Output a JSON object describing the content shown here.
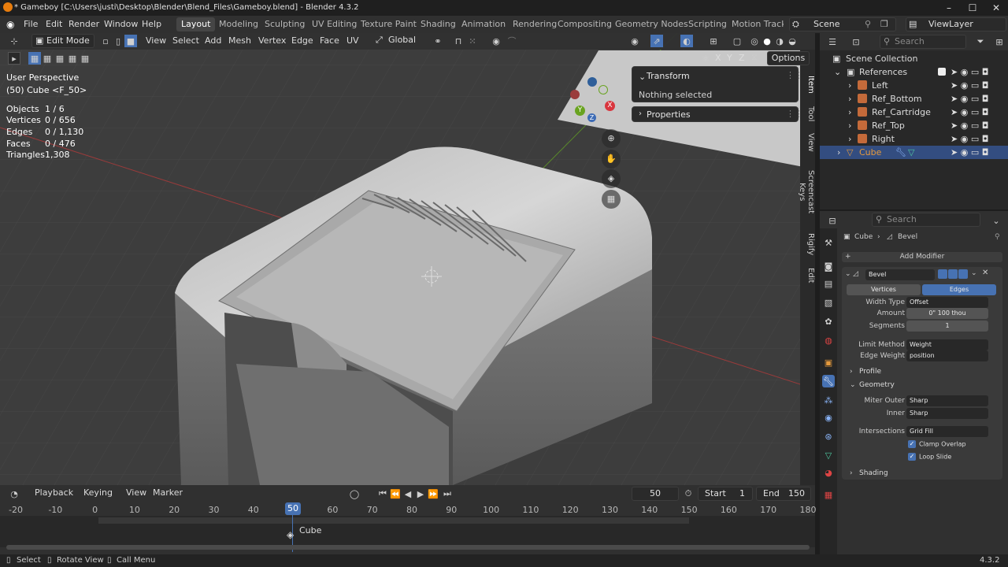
{
  "titlebar": {
    "title": "* Gameboy [C:\\Users\\justi\\Desktop\\Blender\\Blend_Files\\Gameboy.blend] - Blender 4.3.2"
  },
  "menus": [
    "File",
    "Edit",
    "Render",
    "Window",
    "Help"
  ],
  "workspaces": [
    "Layout",
    "Modeling",
    "Sculpting",
    "UV Editing",
    "Texture Paint",
    "Shading",
    "Animation",
    "Rendering",
    "Compositing",
    "Geometry Nodes",
    "Scripting",
    "Motion Tracki"
  ],
  "scene": "Scene",
  "view_layer": "ViewLayer",
  "viewport_header": {
    "mode": "Edit Mode",
    "menus": [
      "View",
      "Select",
      "Add",
      "Mesh",
      "Vertex",
      "Edge",
      "Face",
      "UV"
    ],
    "transform_orientation": "Global",
    "options_label": "Options",
    "axes": [
      "X",
      "Y",
      "Z"
    ]
  },
  "overlay_info": {
    "view_name": "User Perspective",
    "object_name": "(50) Cube <F_50>",
    "stats": [
      {
        "label": "Objects",
        "value": "1 / 6"
      },
      {
        "label": "Vertices",
        "value": "0 / 656"
      },
      {
        "label": "Edges",
        "value": "0 / 1,130"
      },
      {
        "label": "Faces",
        "value": "0 / 476"
      },
      {
        "label": "Triangles",
        "value": "1,308"
      }
    ]
  },
  "gizmo": {
    "x": "X",
    "y": "Y",
    "z": "Z"
  },
  "npanel": {
    "transform_title": "Transform",
    "transform_body": "Nothing selected",
    "properties_title": "Properties",
    "tabs": [
      "Item",
      "Tool",
      "View",
      "Screencast Keys",
      "Rigify",
      "Edit"
    ]
  },
  "outliner": {
    "search_placeholder": "Search",
    "root": "Scene Collection",
    "collection": "References",
    "items": [
      "Left",
      "Ref_Bottom",
      "Ref_Cartridge",
      "Ref_Top",
      "Right",
      "Cube"
    ]
  },
  "properties": {
    "search_placeholder": "Search",
    "breadcrumb_object": "Cube",
    "breadcrumb_modifier": "Bevel",
    "add_modifier": "Add Modifier",
    "modifier_name": "Bevel",
    "affect_tabs": [
      "Vertices",
      "Edges"
    ],
    "width_type_label": "Width Type",
    "width_type": "Offset",
    "amount_label": "Amount",
    "amount": "0\" 100 thou",
    "segments_label": "Segments",
    "segments": "1",
    "limit_method_label": "Limit Method",
    "limit_method": "Weight",
    "edge_weight_label": "Edge Weight",
    "edge_weight": "position",
    "profile_label": "Profile",
    "geometry_label": "Geometry",
    "miter_outer_label": "Miter Outer",
    "miter_outer": "Sharp",
    "inner_label": "Inner",
    "inner": "Sharp",
    "intersections_label": "Intersections",
    "intersections": "Grid Fill",
    "clamp_overlap": "Clamp Overlap",
    "loop_slide": "Loop Slide",
    "shading_label": "Shading"
  },
  "timeline": {
    "menus": [
      "Playback",
      "Keying",
      "View",
      "Marker"
    ],
    "current_frame": "50",
    "start_label": "Start",
    "start": "1",
    "end_label": "End",
    "end": "150",
    "ticks": [
      "-20",
      "-10",
      "0",
      "10",
      "20",
      "30",
      "40",
      "50",
      "60",
      "70",
      "80",
      "90",
      "100",
      "110",
      "120",
      "130",
      "140",
      "150",
      "160",
      "170",
      "180"
    ],
    "track_label": "Cube"
  },
  "statusbar": {
    "select": "Select",
    "rotate": "Rotate View",
    "call_menu": "Call Menu",
    "version": "4.3.2"
  },
  "colors": {
    "accent": "#4772b3",
    "active_object": "#e59a3d",
    "viewport_bg": "#3d3d3d"
  }
}
